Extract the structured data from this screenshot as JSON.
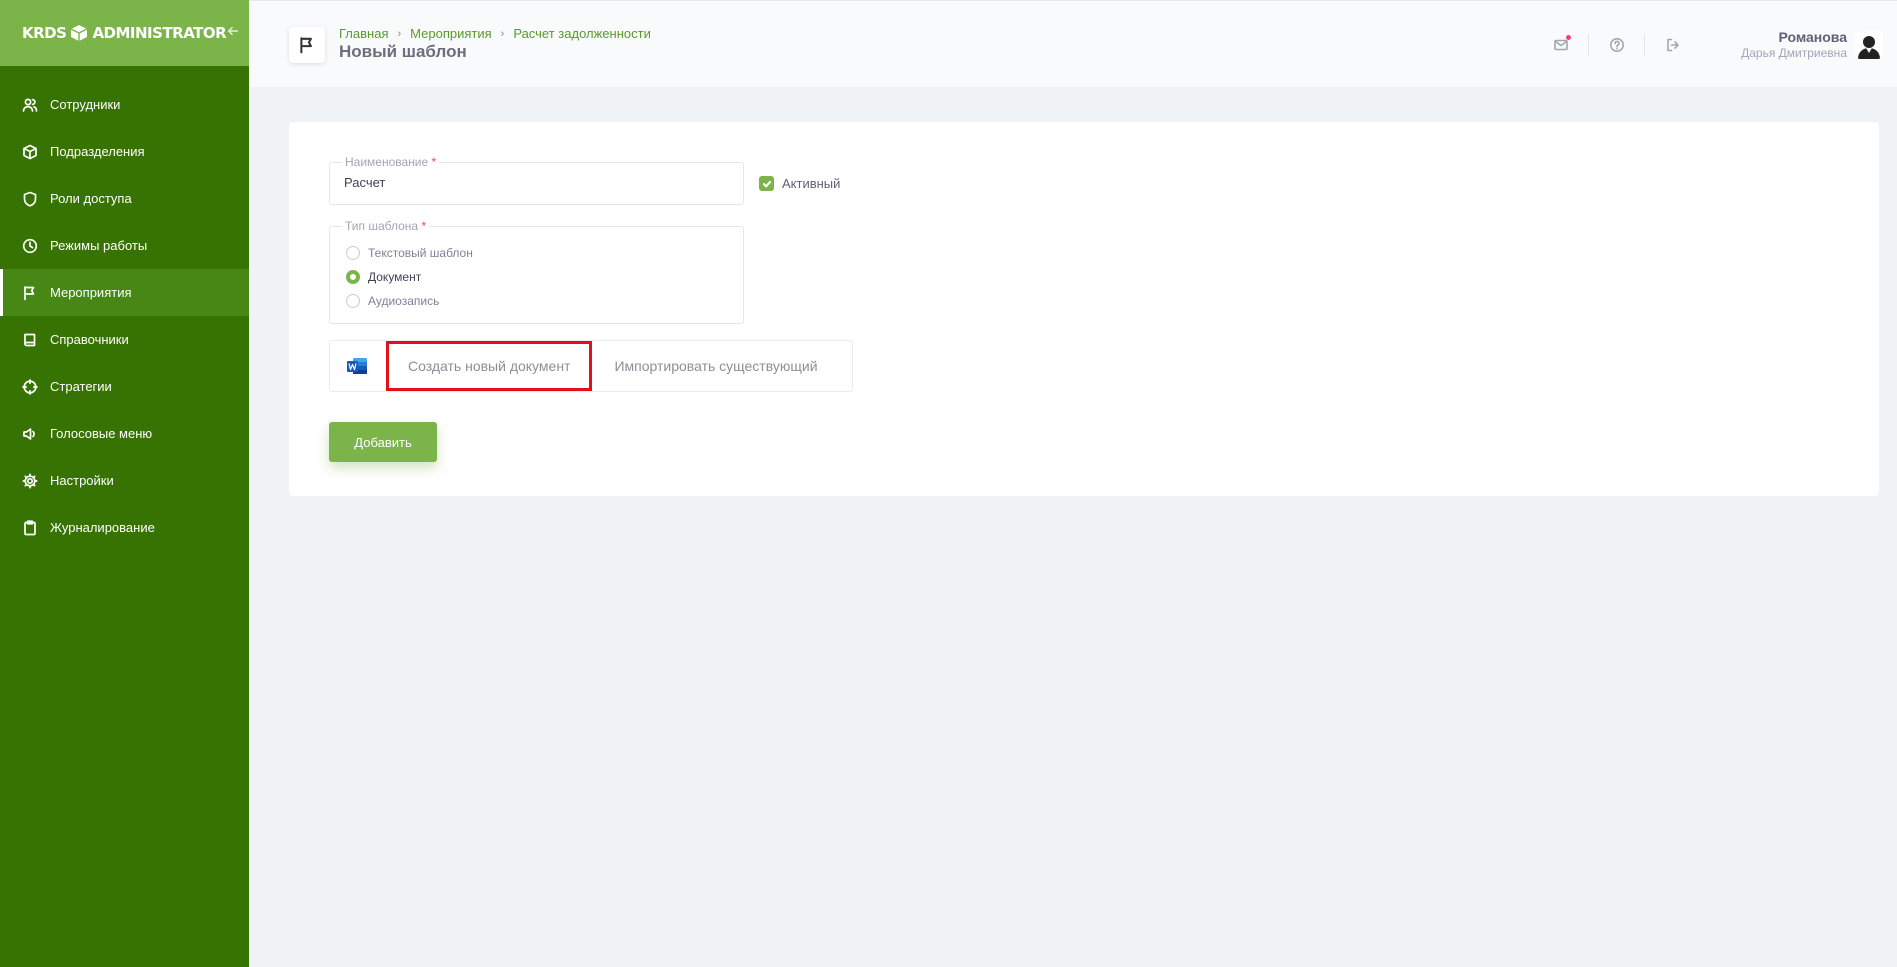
{
  "app": {
    "logo_left": "KRDS",
    "logo_right": "ADMINISTRATOR",
    "accent": "#7bb54a",
    "sidebar_bg": "#367302"
  },
  "sidebar": {
    "collapse_icon": "arrow-left-icon",
    "items": [
      {
        "label": "Сотрудники",
        "icon": "users-icon"
      },
      {
        "label": "Подразделения",
        "icon": "cube-icon"
      },
      {
        "label": "Роли доступа",
        "icon": "shield-icon"
      },
      {
        "label": "Режимы работы",
        "icon": "clock-icon"
      },
      {
        "label": "Мероприятия",
        "icon": "flag-icon",
        "active": true
      },
      {
        "label": "Справочники",
        "icon": "book-icon"
      },
      {
        "label": "Стратегии",
        "icon": "crosshair-icon"
      },
      {
        "label": "Голосовые меню",
        "icon": "speaker-icon"
      },
      {
        "label": "Настройки",
        "icon": "gear-icon"
      },
      {
        "label": "Журналирование",
        "icon": "clipboard-icon"
      }
    ]
  },
  "header": {
    "breadcrumb": [
      "Главная",
      "Мероприятия",
      "Расчет задолженности"
    ],
    "title": "Новый шаблон",
    "user": {
      "last_name": "Романова",
      "first_name": "Дарья Дмитриевна"
    }
  },
  "form": {
    "name_label": "Наименование",
    "name_value": "Расчет",
    "active_label": "Активный",
    "active_checked": true,
    "type_label": "Тип шаблона",
    "type_options": [
      "Текстовый шаблон",
      "Документ",
      "Аудиозапись"
    ],
    "type_selected": "Документ",
    "create_doc": "Создать новый документ",
    "import_doc": "Импортировать существующий",
    "submit": "Добавить"
  }
}
